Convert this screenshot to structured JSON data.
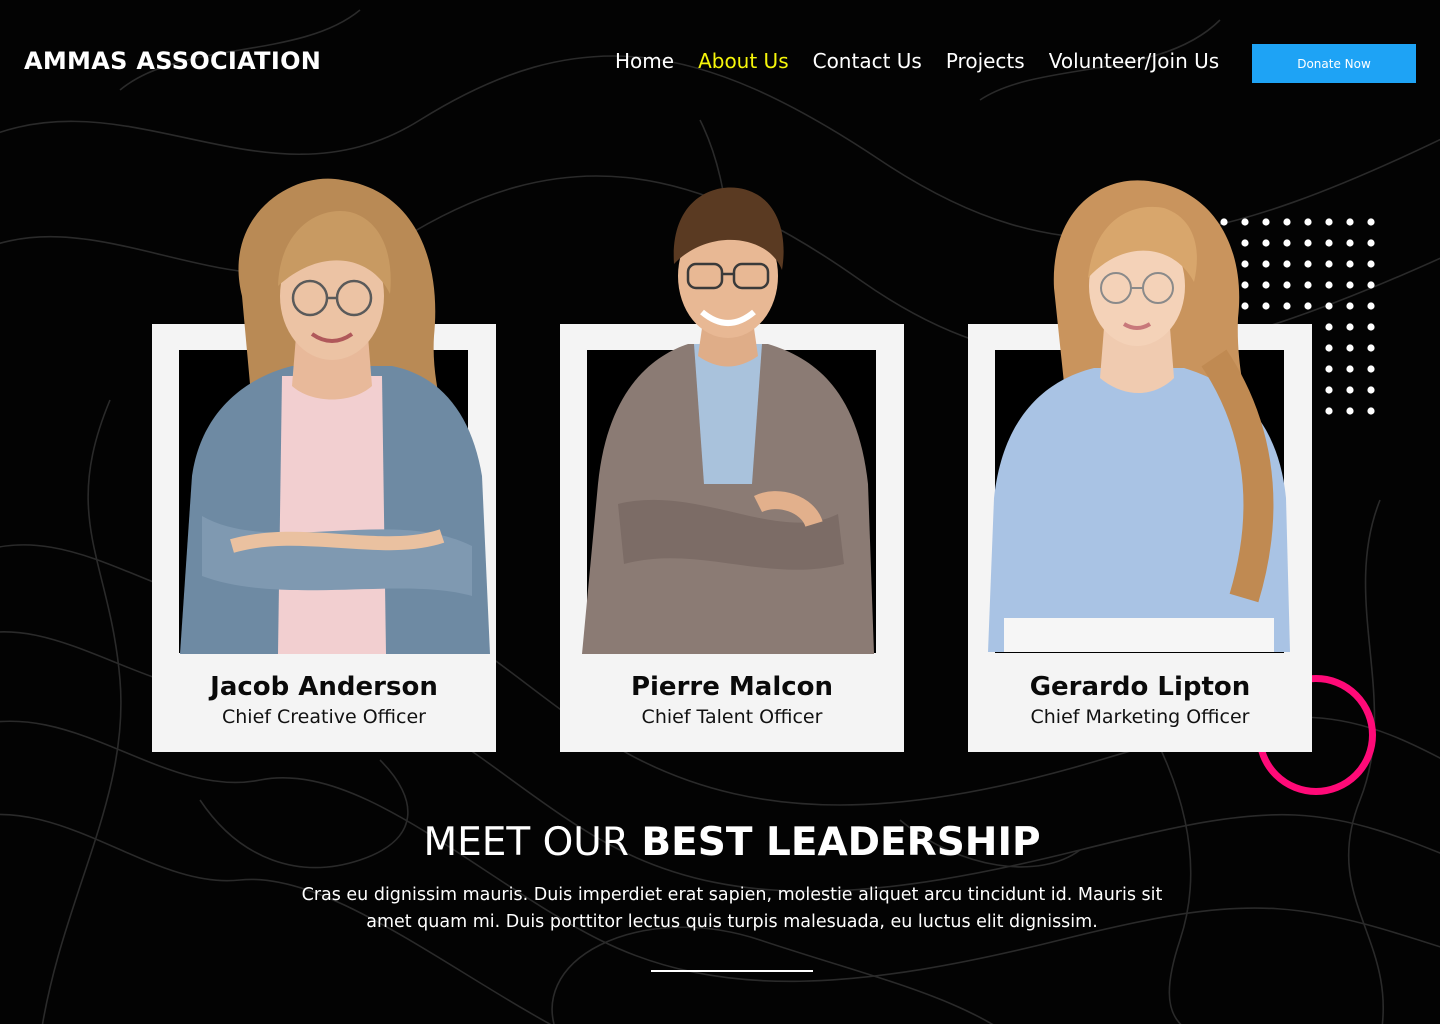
{
  "header": {
    "logo": "AMMAS ASSOCIATION",
    "nav": [
      {
        "label": "Home",
        "active": false
      },
      {
        "label": "About Us",
        "active": true
      },
      {
        "label": "Contact Us",
        "active": false
      },
      {
        "label": "Projects",
        "active": false
      },
      {
        "label": "Volunteer/Join Us",
        "active": false
      }
    ],
    "donate_label": "Donate Now"
  },
  "team": [
    {
      "name": "Jacob Anderson",
      "role": "Chief Creative Officer"
    },
    {
      "name": "Pierre Malcon",
      "role": "Chief Talent Officer"
    },
    {
      "name": "Gerardo Lipton",
      "role": "Chief Marketing Officer"
    }
  ],
  "section": {
    "heading_light": "MEET OUR",
    "heading_bold": "BEST LEADERSHIP",
    "paragraph": "Cras eu dignissim mauris. Duis imperdiet erat sapien, molestie aliquet arcu tincidunt id. Mauris sit amet quam mi. Duis porttitor lectus quis turpis malesuada, eu luctus elit dignissim."
  },
  "colors": {
    "background": "#030303",
    "active_nav": "#f5f50a",
    "donate_button": "#1ea3f5",
    "accent_ring": "#ff0a78",
    "card": "#f4f4f4"
  }
}
